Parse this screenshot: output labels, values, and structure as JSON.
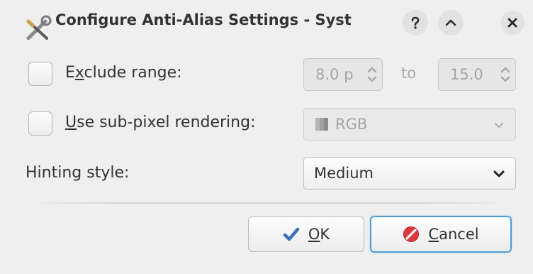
{
  "window": {
    "title": "Configure Anti-Alias Settings - Syst",
    "icons": {
      "app": "tools-icon",
      "help": "help-icon",
      "shade": "shade-up-icon",
      "close": "close-icon"
    }
  },
  "exclude_range": {
    "label_before": "E",
    "label_mnemonic": "x",
    "label_after": "clude range:",
    "checked": false,
    "from_value": "8.0 p",
    "to_label": "to",
    "to_value": "15.0"
  },
  "subpixel": {
    "label_mnemonic": "U",
    "label_after": "se sub-pixel rendering:",
    "checked": false,
    "value": "RGB",
    "value_icon": "rgb-swatch-icon"
  },
  "hinting": {
    "label": "Hinting style:",
    "value": "Medium"
  },
  "buttons": {
    "ok_mnemonic": "O",
    "ok_rest": "K",
    "ok_icon": "checkmark-icon",
    "cancel_mnemonic": "C",
    "cancel_rest": "ancel",
    "cancel_icon": "cancel-icon"
  },
  "colors": {
    "background": "#efefef",
    "focus_border": "#4f9fd9",
    "cancel_icon": "#e0393b",
    "ok_icon": "#3b6fb6"
  }
}
